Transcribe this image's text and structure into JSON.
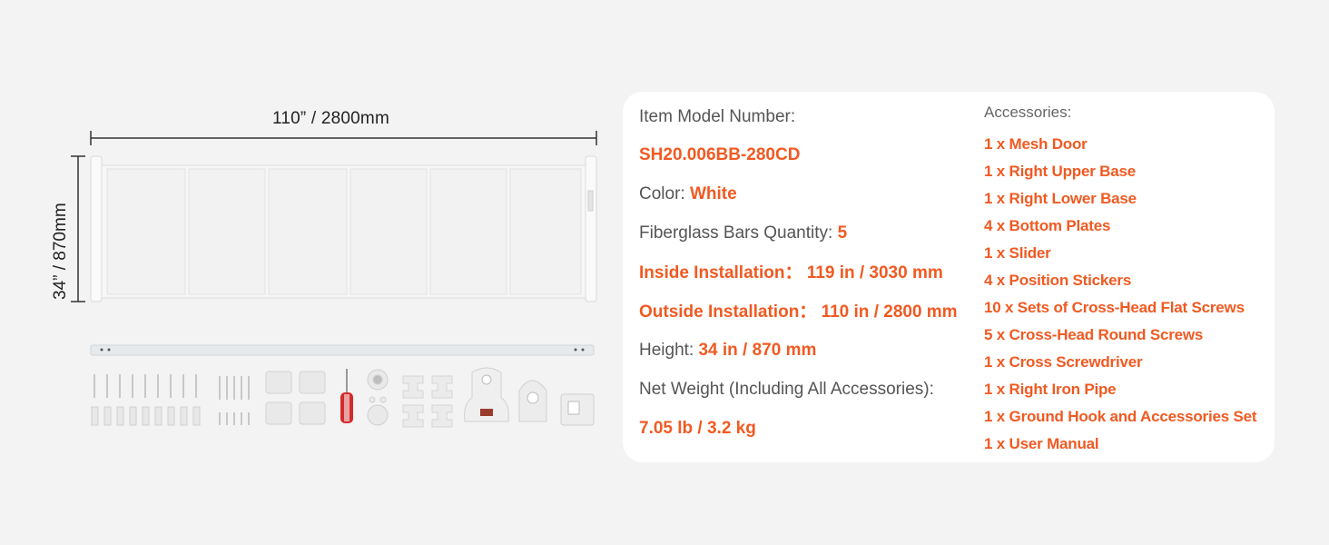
{
  "dimensions": {
    "width_label": "110” /  2800mm",
    "height_label": "34” / 870mm"
  },
  "colors": {
    "accent": "#f05a22",
    "label": "#555555",
    "background": "#f3f3f3",
    "card": "#ffffff"
  },
  "specs": {
    "model_label": "Item Model Number:",
    "model_value": "SH20.006BB-280CD",
    "color_label": "Color:",
    "color_value": "White",
    "bars_label": "Fiberglass Bars Quantity:",
    "bars_value": "5",
    "inside_label": "Inside Installation：",
    "inside_value": "119 in / 3030 mm",
    "outside_label": "Outside Installation：",
    "outside_value": "110 in / 2800 mm",
    "height_label": "Height:",
    "height_value": "34 in / 870 mm",
    "weight_label": "Net Weight (Including All Accessories):",
    "weight_value": "7.05 lb / 3.2 kg"
  },
  "accessories": {
    "title": "Accessories:",
    "items": [
      "1 x Mesh Door",
      "1 x Right Upper Base",
      "1 x Right Lower Base",
      "4 x Bottom Plates",
      "1 x Slider",
      "4 x Position Stickers",
      "10 x Sets of Cross-Head Flat Screws",
      "5 x Cross-Head Round Screws",
      "1 x Cross Screwdriver",
      "1 x Right Iron Pipe",
      "1 x Ground Hook and Accessories Set",
      "1 x User Manual"
    ]
  }
}
